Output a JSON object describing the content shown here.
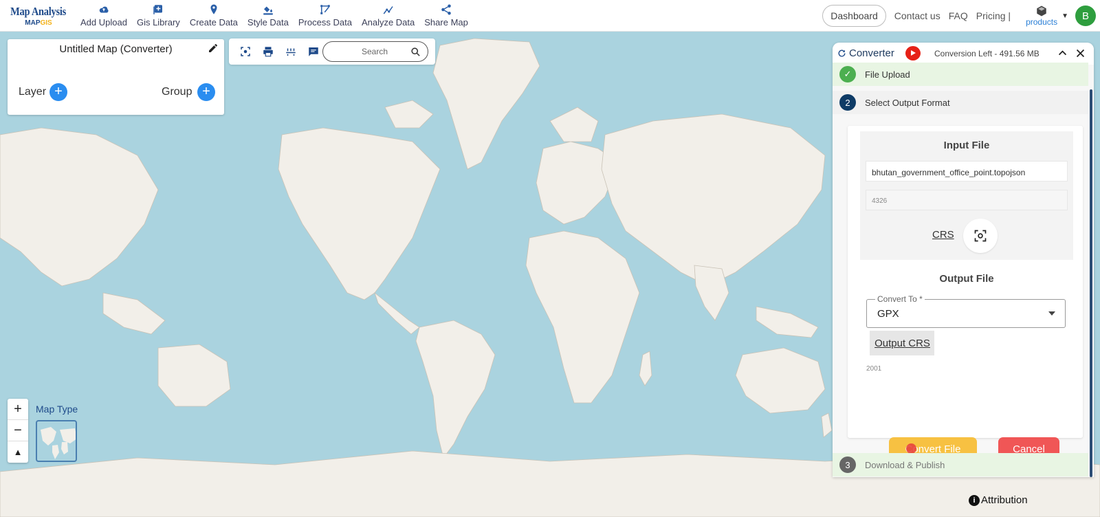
{
  "navbar": {
    "brand_title": "Map Analysis",
    "brand_sub_main": "MAP",
    "brand_sub_accent": "GIS",
    "items": [
      {
        "label": "Add Upload",
        "icon": "cloud-upload-icon"
      },
      {
        "label": "Gis Library",
        "icon": "library-icon"
      },
      {
        "label": "Create Data",
        "icon": "map-pin-icon"
      },
      {
        "label": "Style Data",
        "icon": "paint-bucket-icon"
      },
      {
        "label": "Process Data",
        "icon": "process-icon"
      },
      {
        "label": "Analyze Data",
        "icon": "analyze-icon"
      },
      {
        "label": "Share Map",
        "icon": "share-icon"
      }
    ],
    "dashboard": "Dashboard",
    "contact": "Contact us",
    "faq": "FAQ",
    "pricing": "Pricing |",
    "products": "products",
    "avatar_letter": "B"
  },
  "left_panel": {
    "map_title": "Untitled Map (Converter)",
    "layer_label": "Layer",
    "group_label": "Group"
  },
  "toolbar": {
    "search_placeholder": "Search"
  },
  "map_controls": {
    "zoom_in": "+",
    "zoom_out": "−",
    "reset": "▲",
    "map_type_label": "Map Type",
    "attribution": "Attribution"
  },
  "converter": {
    "title": "Converter",
    "conversion_left": "Conversion Left - 491.56 MB",
    "step1": {
      "label": "File Upload"
    },
    "step2": {
      "number": "2",
      "label": "Select Output Format"
    },
    "step3": {
      "number": "3",
      "label": "Download & Publish"
    },
    "input_title": "Input File",
    "input_filename": "bhutan_government_office_point.topojson",
    "input_crs_value": "4326",
    "crs_link": "CRS",
    "output_title": "Output File",
    "convert_to_label": "Convert To *",
    "convert_to_value": "GPX",
    "output_crs_button": "Output CRS",
    "output_crs_value": "2001",
    "convert_button": "Convert File",
    "cancel_button": "Cancel"
  },
  "colors": {
    "brand_blue": "#1e4a8a",
    "accent_yellow": "#f3b21a",
    "ocean": "#aad3df",
    "land": "#f2efe9",
    "convert_yellow": "#f7c142",
    "cancel_red": "#f05656",
    "step_success": "#4caf50",
    "step_active": "#0e3b66"
  }
}
